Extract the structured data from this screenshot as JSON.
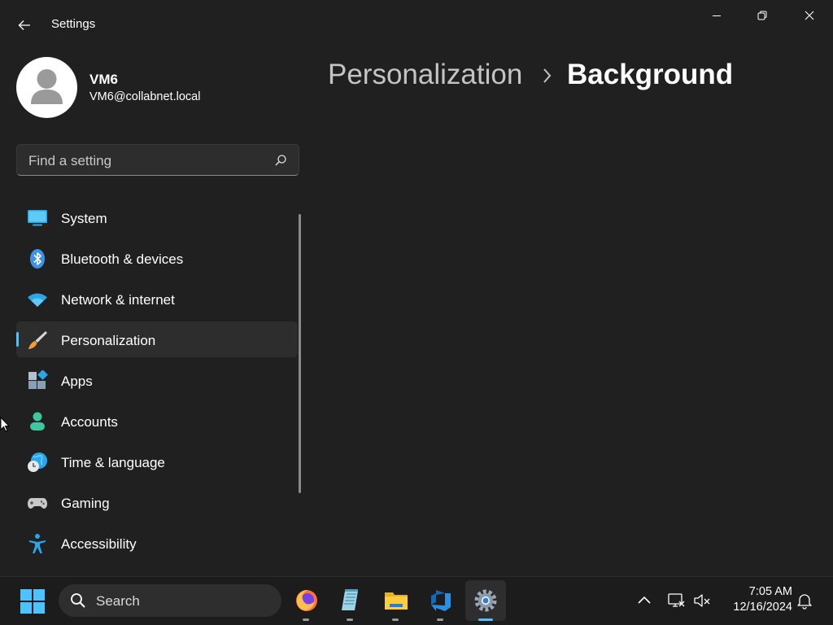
{
  "window": {
    "title": "Settings"
  },
  "profile": {
    "name": "VM6",
    "email": "VM6@collabnet.local"
  },
  "search": {
    "placeholder": "Find a setting"
  },
  "nav": {
    "items": [
      {
        "label": "System",
        "icon": "system-icon",
        "selected": false
      },
      {
        "label": "Bluetooth & devices",
        "icon": "bluetooth-icon",
        "selected": false
      },
      {
        "label": "Network & internet",
        "icon": "wifi-icon",
        "selected": false
      },
      {
        "label": "Personalization",
        "icon": "paintbrush-icon",
        "selected": true
      },
      {
        "label": "Apps",
        "icon": "apps-icon",
        "selected": false
      },
      {
        "label": "Accounts",
        "icon": "accounts-icon",
        "selected": false
      },
      {
        "label": "Time & language",
        "icon": "time-language-icon",
        "selected": false
      },
      {
        "label": "Gaming",
        "icon": "gamepad-icon",
        "selected": false
      },
      {
        "label": "Accessibility",
        "icon": "accessibility-icon",
        "selected": false
      }
    ]
  },
  "breadcrumb": {
    "parent": "Personalization",
    "current": "Background"
  },
  "taskbar": {
    "search_label": "Search",
    "apps": [
      "firefox-icon",
      "notepad-icon",
      "file-explorer-icon",
      "azure-devops-icon",
      "settings-icon"
    ],
    "active_app": "settings-icon",
    "time": "7:05 AM",
    "date": "12/16/2024"
  },
  "colors": {
    "background": "#202020",
    "accent": "#4cc2ff",
    "selected_item": "#2d2d2d",
    "taskbar": "#1c1c1c"
  }
}
